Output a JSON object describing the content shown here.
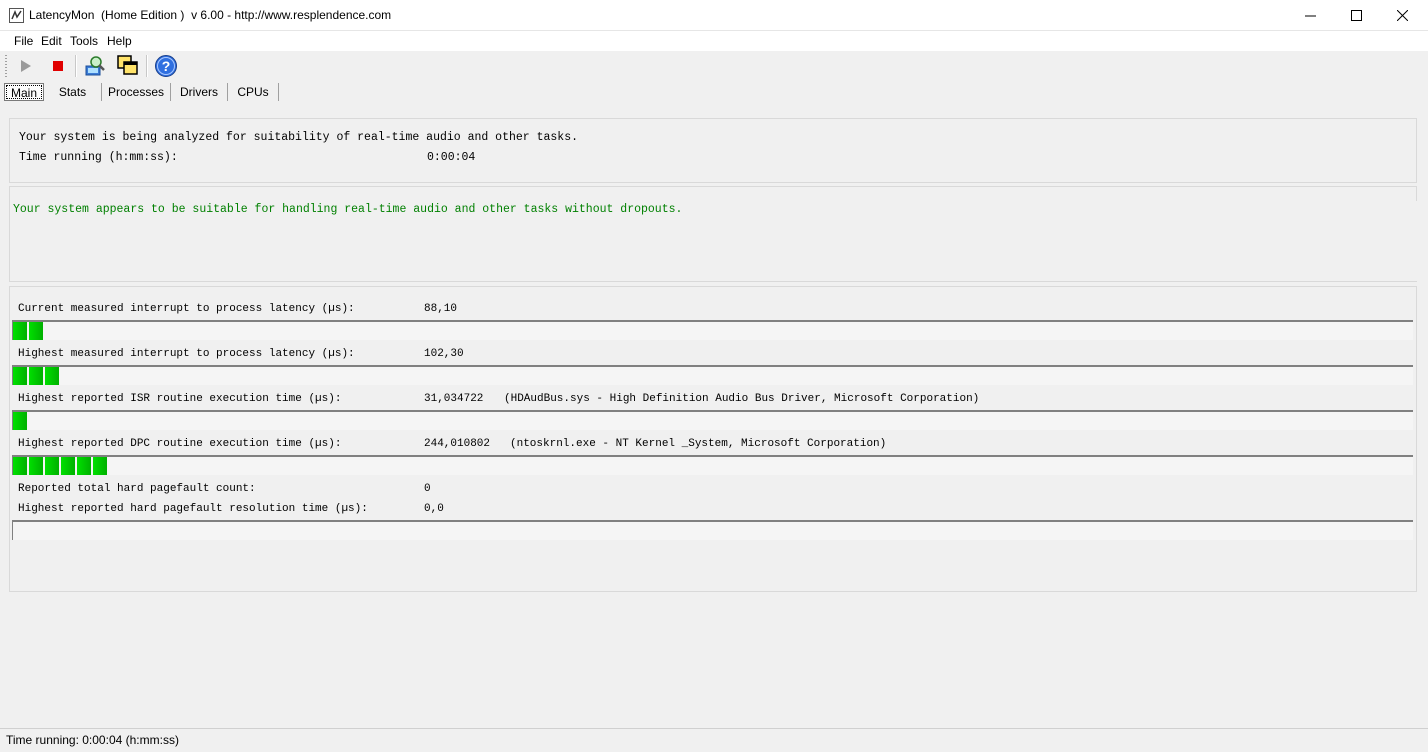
{
  "window": {
    "title": "LatencyMon  (Home Edition )  v 6.00 - http://www.resplendence.com"
  },
  "menu": [
    "File",
    "Edit",
    "Tools",
    "Help"
  ],
  "toolbar": {
    "icons": [
      "play-icon",
      "stop-icon",
      "search-drivers-icon",
      "window-icon",
      "help-icon"
    ]
  },
  "tabs": [
    "Main",
    "Stats",
    "Processes",
    "Drivers",
    "CPUs"
  ],
  "active_tab": "Main",
  "status_panel": {
    "line1": "Your system is being analyzed for suitability of real-time audio and other tasks.",
    "time_label": "Time running (h:mm:ss):",
    "time_value": "0:00:04"
  },
  "verdict": {
    "text": "Your system appears to be suitable for handling real-time audio and other tasks without dropouts.",
    "color": "#008000"
  },
  "metrics": {
    "current_latency": {
      "label": "Current measured interrupt to process latency (µs):",
      "value": "88,10",
      "blocks": 2
    },
    "highest_latency": {
      "label": "Highest measured interrupt to process latency (µs):",
      "value": "102,30",
      "blocks": 3
    },
    "isr": {
      "label": "Highest reported ISR routine execution time (µs):",
      "value": "31,034722",
      "detail": "(HDAudBus.sys - High Definition Audio Bus Driver, Microsoft Corporation)",
      "blocks": 1
    },
    "dpc": {
      "label": "Highest reported DPC routine execution time (µs):",
      "value": "244,010802",
      "detail": "(ntoskrnl.exe - NT Kernel _System, Microsoft Corporation)",
      "blocks": 6
    },
    "pagefault_count": {
      "label": "Reported total hard pagefault count:",
      "value": "0"
    },
    "pagefault_time": {
      "label": "Highest reported hard pagefault resolution time (µs):",
      "value": "0,0",
      "blocks": 0
    }
  },
  "statusbar": {
    "text": "Time running: 0:00:04  (h:mm:ss)"
  }
}
